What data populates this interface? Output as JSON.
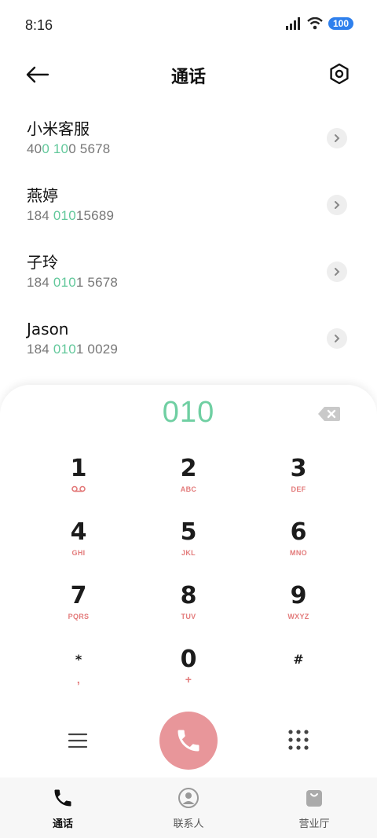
{
  "status_bar": {
    "time": "8:16",
    "battery": "100",
    "icons": [
      "signal-icon",
      "wifi-icon",
      "battery-icon"
    ]
  },
  "header": {
    "title": "通话",
    "back_icon": "arrow-left-icon",
    "settings_icon": "gear-icon"
  },
  "contacts": [
    {
      "name": "小米客服",
      "number_parts": [
        "40",
        "0",
        " ",
        "10",
        "0 5678"
      ]
    },
    {
      "name": "燕婷",
      "number_parts": [
        "184 ",
        "010",
        "15689",
        "",
        ""
      ]
    },
    {
      "name": "子玲",
      "number_parts": [
        "184 ",
        "010",
        "1 5678",
        "",
        ""
      ]
    },
    {
      "name": "Jason",
      "number_parts": [
        "184 ",
        "010",
        "1 0029",
        "",
        ""
      ]
    }
  ],
  "dialer": {
    "input": "010",
    "keys": [
      {
        "digit": "1",
        "letters": "voicemail"
      },
      {
        "digit": "2",
        "letters": "ABC"
      },
      {
        "digit": "3",
        "letters": "DEF"
      },
      {
        "digit": "4",
        "letters": "GHI"
      },
      {
        "digit": "5",
        "letters": "JKL"
      },
      {
        "digit": "6",
        "letters": "MNO"
      },
      {
        "digit": "7",
        "letters": "PQRS"
      },
      {
        "digit": "8",
        "letters": "TUV"
      },
      {
        "digit": "9",
        "letters": "WXYZ"
      },
      {
        "digit": "*",
        "letters": ","
      },
      {
        "digit": "0",
        "letters": "+"
      },
      {
        "digit": "#",
        "letters": ""
      }
    ]
  },
  "bottom_nav": [
    {
      "label": "通话",
      "icon": "phone-icon",
      "active": true
    },
    {
      "label": "联系人",
      "icon": "person-icon",
      "active": false
    },
    {
      "label": "营业厅",
      "icon": "shopping-bag-icon",
      "active": false
    }
  ],
  "colors": {
    "highlight": "#62c89b",
    "dial_display": "#6fcfa2",
    "call_button": "#e8969a",
    "key_letters": "#e37b7b",
    "battery": "#2f80ed"
  }
}
